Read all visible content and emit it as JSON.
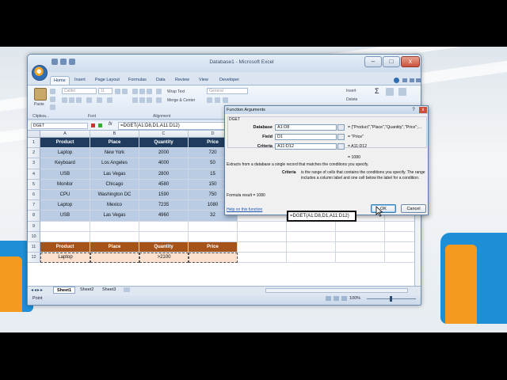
{
  "window": {
    "title": "Database1 - Microsoft Excel",
    "min": "–",
    "max": "□",
    "close": "x"
  },
  "ribbon": {
    "tabs": [
      "Home",
      "Insert",
      "Page Layout",
      "Formulas",
      "Data",
      "Review",
      "View",
      "Developer"
    ],
    "paste": "Paste",
    "font_name": "Calibri",
    "font_size": "11",
    "wrap_text": "Wrap Text",
    "number_format": "General",
    "merge_center": "Merge & Center",
    "insert": "Insert",
    "delete": "Delete",
    "sum": "Σ",
    "groups": [
      "Clipboa...",
      "Font",
      "Alignment"
    ]
  },
  "formula_bar": {
    "name_box": "DGET",
    "fx": "fx",
    "formula": "=DGET(A1:D8,D1,A11:D12)"
  },
  "columns": [
    "A",
    "B",
    "C",
    "D"
  ],
  "rows": [
    "1",
    "2",
    "3",
    "4",
    "5",
    "6",
    "7",
    "8",
    "9",
    "10",
    "11",
    "12"
  ],
  "table": {
    "headers": [
      "Product",
      "Place",
      "Quantity",
      "Price"
    ],
    "rows": [
      [
        "Laptop",
        "New York",
        "2000",
        "720"
      ],
      [
        "Keyboard",
        "Los Angeles",
        "4000",
        "50"
      ],
      [
        "USB",
        "Las Vegas",
        "2800",
        "15"
      ],
      [
        "Monitor",
        "Chicago",
        "4580",
        "150"
      ],
      [
        "CPU",
        "Washington DC",
        "1590",
        "750"
      ],
      [
        "Laptop",
        "Mexico",
        "7235",
        "1080"
      ],
      [
        "USB",
        "Las Vegas",
        "4960",
        "32"
      ]
    ]
  },
  "criteria": {
    "headers": [
      "Product",
      "Place",
      "Quantity",
      "Price"
    ],
    "row": [
      "Laptop",
      "",
      ">2100",
      ""
    ]
  },
  "active_cell_formula": "=DGET(A1:D8,D1,A11:D12)",
  "sheets": [
    "Sheet1",
    "Sheet2",
    "Sheet3"
  ],
  "status": {
    "mode": "Point",
    "zoom": "100%"
  },
  "dialog": {
    "title": "Function Arguments",
    "func": "DGET",
    "args": [
      {
        "label": "Database",
        "value": "A1:D8",
        "result": "= {\"Product\",\"Place\",\"Quantity\",\"Price\";..."
      },
      {
        "label": "Field",
        "value": "D1",
        "result": "= \"Price\""
      },
      {
        "label": "Criteria",
        "value": "A11:D12",
        "result": "= A11:D12"
      }
    ],
    "result_line": "= 1080",
    "description": "Extracts from a database a single record that matches the conditions you specify.",
    "crit_label": "Criteria",
    "crit_desc": "is the range of cells that contains the conditions you specify. The range includes a column label and one cell below the label for a condition.",
    "formula_result": "Formula result =   1080",
    "help": "Help on this function",
    "ok": "OK",
    "cancel": "Cancel",
    "close": "x"
  },
  "colors": {
    "header": "#1f3c5e",
    "data": "#b9cce4",
    "criteria": "#a55318"
  }
}
